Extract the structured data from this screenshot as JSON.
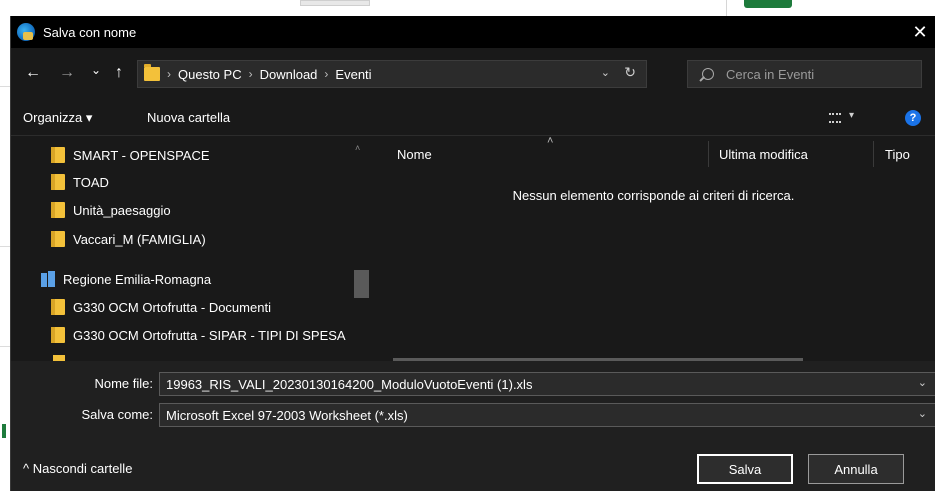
{
  "dialog": {
    "title": "Salva con nome",
    "close": "✕"
  },
  "nav": {
    "back": "←",
    "forward": "→",
    "recent": "⌄",
    "up": "↑",
    "breadcrumb": [
      "Questo PC",
      "Download",
      "Eventi"
    ],
    "separator": "›",
    "dropdown": "⌄",
    "refresh": "↻",
    "search_placeholder": "Cerca in Eventi"
  },
  "toolbar": {
    "organize": "Organizza ▾",
    "new_folder": "Nuova cartella",
    "view_caret": "▾",
    "help": "?"
  },
  "sidebar": {
    "items": [
      {
        "label": "SMART - OPENSPACE",
        "icon": "folder-icon"
      },
      {
        "label": "TOAD",
        "icon": "folder-icon"
      },
      {
        "label": "Unità_paesaggio",
        "icon": "folder-icon"
      },
      {
        "label": "Vaccari_M (FAMIGLIA)",
        "icon": "folder-icon"
      },
      {
        "label": "Regione Emilia-Romagna",
        "icon": "building-icon"
      },
      {
        "label": "G330 OCM Ortofrutta - Documenti",
        "icon": "folder-icon"
      },
      {
        "label": "G330 OCM Ortofrutta - SIPAR - TIPI DI SPESA",
        "icon": "folder-icon"
      }
    ],
    "scroll_up": "˄"
  },
  "content": {
    "columns": [
      "Nome",
      "Ultima modifica",
      "Tipo"
    ],
    "sort_caret": "˄",
    "empty_message": "Nessun elemento corrisponde ai criteri di ricerca.",
    "scroll_left": "‹",
    "scroll_right": "›"
  },
  "footer": {
    "filename_label": "Nome file:",
    "filename_value": "19963_RIS_VALI_20230130164200_ModuloVuotoEventi (1).xls",
    "savetype_label": "Salva come:",
    "savetype_value": "Microsoft Excel 97-2003 Worksheet (*.xls)",
    "field_caret": "⌄",
    "hide_folders": "^  Nascondi cartelle",
    "save_button": "Salva",
    "cancel_button": "Annulla"
  },
  "colors": {
    "dialog_bg": "#191919",
    "titlebar_bg": "#000000",
    "footer_bg": "#202020",
    "folder": "#f3c13a",
    "accent_help": "#1a73e8"
  }
}
